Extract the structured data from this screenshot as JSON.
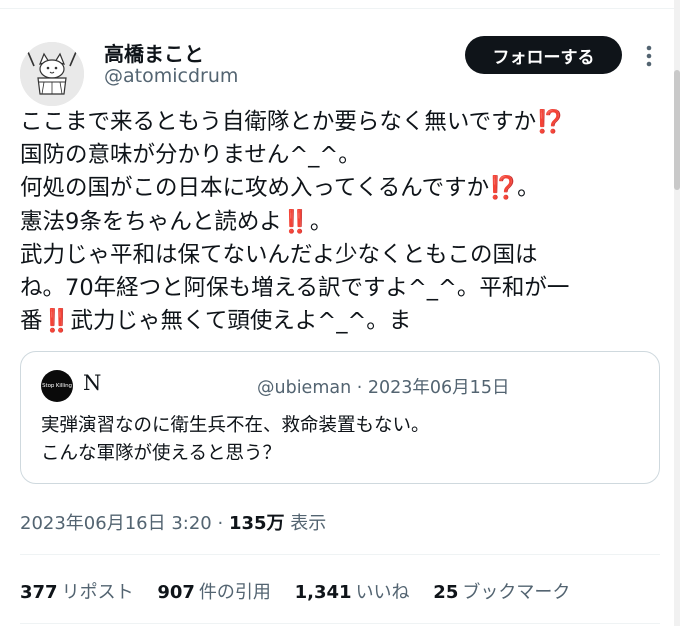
{
  "author": {
    "name": "高橋まこと",
    "handle": "@atomicdrum"
  },
  "follow_button_label": "フォローする",
  "tweet": {
    "lines": [
      {
        "text": "ここまで来るともう自衛隊とか要らなく無いですか",
        "emoji": "⁉️"
      },
      {
        "text": "国防の意味が分かりません^_^。"
      },
      {
        "text": "何処の国がこの日本に攻め入ってくるんですか",
        "emoji": "⁉️",
        "after": "。"
      },
      {
        "text": "憲法9条をちゃんと読めよ",
        "emoji": "‼️",
        "after": "。"
      },
      {
        "text": "武力じゃ平和は保てないんだよ少なくともこの国は"
      },
      {
        "text": "ね。70年経つと阿保も増える訳ですよ^_^。平和が一"
      },
      {
        "text": "番",
        "emoji": "‼️",
        "after": "武力じゃ無くて頭使えよ^_^。ま"
      }
    ]
  },
  "quote": {
    "avatar_text": "Stop Killing",
    "name": "N",
    "handle_date": "@ubieman · 2023年06月15日",
    "lines": [
      "実弾演習なのに衛生兵不在、救命装置もない。",
      "こんな軍隊が使えると思う？"
    ]
  },
  "meta": {
    "timestamp": "2023年06月16日 3:20",
    "separator": " · ",
    "views_count": "135万",
    "views_label": "表示"
  },
  "stats": [
    {
      "num": "377",
      "label": "リポスト"
    },
    {
      "num": "907",
      "label": "件の引用"
    },
    {
      "num": "1,341",
      "label": "いいね"
    },
    {
      "num": "25",
      "label": "ブックマーク"
    }
  ],
  "colors": {
    "text": "#0f1419",
    "secondary": "#536471",
    "emoji_interrobang": "#e62ad6",
    "emoji_bangbang": "#e11c2e"
  }
}
